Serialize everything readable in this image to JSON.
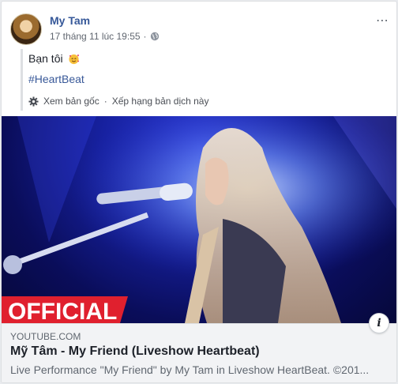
{
  "post": {
    "author": "My Tam",
    "timestamp": "17 tháng 11 lúc 19:55",
    "privacy_icon": "globe-icon",
    "more_icon": "⋯",
    "text": "Bạn tôi",
    "emoji": "smiling-face-with-hearts",
    "hashtag": "#HeartBeat",
    "see_original": "Xem bản gốc",
    "separator": "·",
    "rate_translation": "Xếp hạng bản dịch này"
  },
  "media": {
    "badge_text": "OFFICIAL"
  },
  "link_preview": {
    "domain": "YOUTUBE.COM",
    "title": "Mỹ Tâm - My Friend (Liveshow Heartbeat)",
    "description": "Live Performance \"My Friend\" by My Tam in Liveshow HeartBeat. ©201...",
    "info_icon": "i"
  },
  "colors": {
    "link_blue": "#365899",
    "badge_red": "#e0202e",
    "stage_blue": "#1721a0"
  }
}
